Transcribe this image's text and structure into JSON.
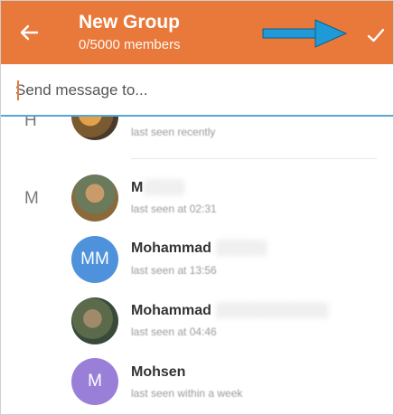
{
  "header": {
    "title": "New Group",
    "subtitle": "0/5000 members",
    "background": "#e9793a",
    "back_icon": "arrow-left-icon",
    "done_icon": "checkmark-icon",
    "annotation_icon": "arrow-right-annotation-icon",
    "annotation_color": "#1f9ad6"
  },
  "search": {
    "placeholder": "Send message to...",
    "value": "",
    "accent": "#56a6d6"
  },
  "contacts": [
    {
      "section": "H",
      "name": "",
      "status": "last seen recently",
      "avatar_type": "photo"
    },
    {
      "section": "M",
      "name": "M",
      "status": "last seen at 02:31",
      "avatar_type": "photo"
    },
    {
      "section": "",
      "name": "Mohammad",
      "status": "last seen at 13:56",
      "avatar_type": "initials",
      "initials": "MM",
      "avatar_color": "#4d92db"
    },
    {
      "section": "",
      "name": "Mohammad",
      "status": "last seen at 04:46",
      "avatar_type": "photo"
    },
    {
      "section": "",
      "name": "Mohsen",
      "status": "last seen within a week",
      "avatar_type": "initials",
      "initials": "M",
      "avatar_color": "#9a7fd9"
    }
  ]
}
